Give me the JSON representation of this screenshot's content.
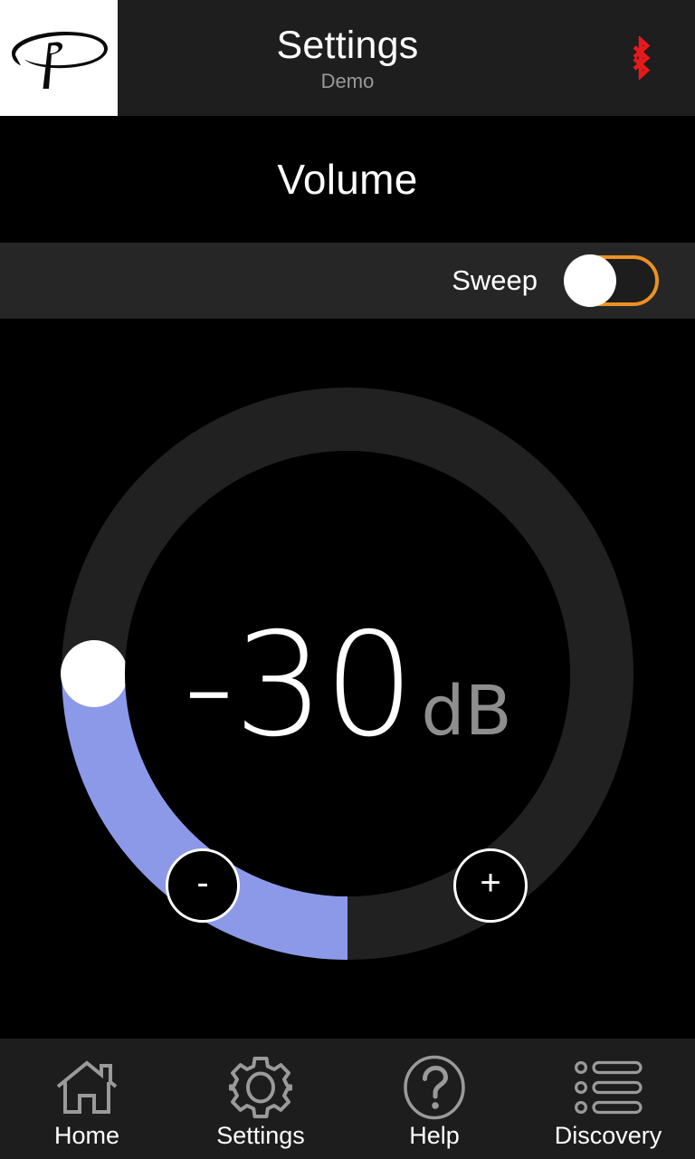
{
  "header": {
    "logo_icon": "paradigm-p-logo",
    "title": "Settings",
    "subtitle": "Demo",
    "bluetooth_icon": "bluetooth-icon",
    "bluetooth_color": "#e8191c",
    "background": "#1e1e1e"
  },
  "section": {
    "title": "Volume"
  },
  "sweep": {
    "label": "Sweep",
    "toggle_state": "off",
    "toggle_border_color": "#eb9124",
    "toggle_knob_color": "#ffffff",
    "row_background": "#262626"
  },
  "dial": {
    "value": "-30",
    "unit": "dB",
    "unit_color": "#8e8e8e",
    "track_color": "#212121",
    "fill_color": "#8c99e8",
    "thumb_color": "#ffffff",
    "decrease_label": "-",
    "increase_label": "+",
    "decrease_icon": "minus-icon",
    "increase_icon": "plus-icon",
    "thumb_icon": "slider-thumb"
  },
  "navbar": {
    "items": [
      {
        "label": "Home",
        "icon": "home-icon"
      },
      {
        "label": "Settings",
        "icon": "gear-icon"
      },
      {
        "label": "Help",
        "icon": "question-circle-icon"
      },
      {
        "label": "Discovery",
        "icon": "list-icon"
      }
    ]
  }
}
